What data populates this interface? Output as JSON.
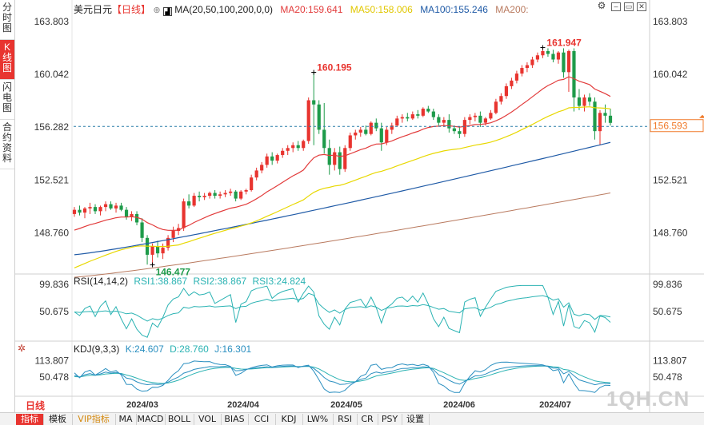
{
  "symbol": "美元日元",
  "period": "【日线】",
  "side_tabs": [
    "分时图",
    "K线图",
    "闪电图",
    "合约资料"
  ],
  "active_tab": "K线图",
  "ma": {
    "label": "MA(20,50,100,200,0,0)",
    "ma20": "MA20:159.641",
    "ma50": "MA50:158.006",
    "ma100": "MA100:155.246",
    "ma200": "MA200:"
  },
  "rsi": {
    "label": "RSI(14,14,2)",
    "rsi1": "RSI1:38.867",
    "rsi2": "RSI2:38.867",
    "rsi3": "RSI3:24.824"
  },
  "kdj": {
    "label": "KDJ(9,3,3)",
    "k": "K:24.607",
    "d": "D:28.760",
    "j": "J:16.301"
  },
  "bottom_left": "日线",
  "bottom_tabs": [
    "指标",
    "模板",
    "VIP指标",
    "MA",
    "MACD",
    "BOLL",
    "VOL",
    "BIAS",
    "CCI",
    "KDJ",
    "LW%",
    "RSI",
    "CR",
    "PSY",
    "设置"
  ],
  "watermark": "1QH.CN",
  "colors": {
    "up": "#e8342f",
    "down": "#1e9b4a",
    "ma20": "#e23b3b",
    "ma50": "#e8d800",
    "ma100": "#1f5aa6",
    "ma200": "#b97a5f",
    "rsi": "#2bb3b3",
    "kdj_k": "#2a8fc0",
    "current": "#f07a2a",
    "high_label": "#e8342f",
    "low_label": "#1e9b4a"
  },
  "icons": [
    "settings-icon",
    "minimize-icon",
    "restore-icon",
    "close-icon"
  ],
  "chart_data": [
    {
      "type": "candlestick",
      "x_labels": [
        "2024/03",
        "2024/04",
        "2024/05",
        "2024/06",
        "2024/07"
      ],
      "y_ticks": [
        "163.803",
        "160.042",
        "156.282",
        "152.521",
        "148.760"
      ],
      "ylim": [
        146.0,
        164.2
      ],
      "current_price": "156.593",
      "high_annotation": "161.947",
      "high_label_left": "160.195",
      "low_annotation": "146.477",
      "ohlc": [
        [
          150.1,
          150.6,
          149.9,
          150.4
        ],
        [
          150.4,
          150.7,
          150.0,
          150.2
        ],
        [
          150.2,
          150.6,
          149.8,
          150.5
        ],
        [
          150.5,
          150.9,
          150.1,
          150.6
        ],
        [
          150.6,
          150.8,
          150.1,
          150.3
        ],
        [
          150.3,
          150.7,
          150.0,
          150.6
        ],
        [
          150.6,
          151.0,
          150.3,
          150.8
        ],
        [
          150.8,
          151.0,
          150.4,
          150.5
        ],
        [
          150.5,
          150.9,
          150.2,
          150.7
        ],
        [
          150.7,
          150.9,
          150.3,
          150.4
        ],
        [
          150.4,
          150.6,
          149.7,
          149.9
        ],
        [
          149.9,
          150.3,
          149.6,
          150.1
        ],
        [
          150.1,
          150.3,
          149.3,
          149.5
        ],
        [
          149.5,
          149.8,
          148.1,
          148.4
        ],
        [
          148.4,
          148.6,
          146.5,
          147.2
        ],
        [
          147.2,
          148.0,
          146.48,
          147.8
        ],
        [
          147.8,
          148.2,
          147.0,
          147.3
        ],
        [
          147.3,
          148.0,
          146.9,
          147.7
        ],
        [
          147.7,
          148.6,
          147.5,
          148.4
        ],
        [
          148.4,
          149.2,
          148.1,
          148.9
        ],
        [
          148.9,
          149.4,
          148.6,
          149.1
        ],
        [
          149.1,
          151.2,
          148.9,
          151.0
        ],
        [
          151.0,
          151.5,
          150.5,
          150.7
        ],
        [
          150.7,
          151.6,
          150.6,
          151.4
        ],
        [
          151.4,
          151.7,
          151.0,
          151.3
        ],
        [
          151.3,
          151.6,
          151.1,
          151.4
        ],
        [
          151.4,
          151.7,
          151.2,
          151.6
        ],
        [
          151.6,
          151.8,
          151.2,
          151.4
        ],
        [
          151.4,
          151.7,
          151.2,
          151.5
        ],
        [
          151.5,
          151.8,
          151.3,
          151.6
        ],
        [
          151.6,
          151.9,
          151.4,
          151.7
        ],
        [
          151.7,
          151.8,
          151.0,
          151.2
        ],
        [
          151.2,
          151.8,
          151.1,
          151.7
        ],
        [
          151.7,
          151.9,
          151.5,
          151.8
        ],
        [
          151.8,
          152.9,
          151.7,
          152.7
        ],
        [
          152.7,
          153.4,
          152.5,
          153.2
        ],
        [
          153.2,
          153.8,
          153.0,
          153.6
        ],
        [
          153.6,
          154.4,
          153.4,
          154.2
        ],
        [
          154.2,
          154.5,
          153.6,
          153.9
        ],
        [
          153.9,
          154.4,
          153.7,
          154.3
        ],
        [
          154.3,
          154.8,
          154.1,
          154.6
        ],
        [
          154.6,
          155.0,
          154.3,
          154.8
        ],
        [
          154.8,
          155.2,
          154.5,
          155.0
        ],
        [
          155.0,
          155.3,
          154.6,
          154.8
        ],
        [
          154.8,
          155.4,
          154.6,
          155.3
        ],
        [
          155.3,
          158.4,
          155.1,
          158.2
        ],
        [
          158.2,
          160.19,
          155.0,
          157.9
        ],
        [
          157.9,
          158.2,
          155.8,
          156.1
        ],
        [
          156.1,
          158.0,
          154.4,
          154.8
        ],
        [
          154.8,
          155.4,
          152.9,
          153.6
        ],
        [
          153.6,
          154.8,
          153.2,
          154.5
        ],
        [
          154.5,
          154.9,
          152.9,
          153.3
        ],
        [
          153.3,
          155.0,
          153.1,
          154.8
        ],
        [
          154.8,
          155.9,
          154.6,
          155.7
        ],
        [
          155.7,
          156.1,
          155.4,
          155.9
        ],
        [
          155.9,
          156.3,
          155.6,
          156.1
        ],
        [
          156.1,
          156.4,
          155.7,
          155.8
        ],
        [
          155.8,
          156.7,
          155.7,
          156.6
        ],
        [
          156.6,
          156.9,
          156.0,
          156.2
        ],
        [
          156.2,
          156.6,
          154.6,
          155.2
        ],
        [
          155.2,
          156.3,
          155.0,
          156.1
        ],
        [
          156.1,
          156.6,
          155.8,
          156.4
        ],
        [
          156.4,
          157.1,
          156.3,
          156.9
        ],
        [
          156.9,
          157.2,
          156.6,
          157.0
        ],
        [
          157.0,
          157.3,
          156.7,
          156.9
        ],
        [
          156.9,
          157.4,
          156.8,
          157.2
        ],
        [
          157.2,
          157.5,
          156.9,
          157.1
        ],
        [
          157.1,
          157.7,
          157.0,
          157.6
        ],
        [
          157.6,
          157.8,
          157.3,
          157.4
        ],
        [
          157.4,
          157.6,
          156.8,
          157.0
        ],
        [
          157.0,
          157.2,
          156.4,
          156.6
        ],
        [
          156.6,
          157.0,
          156.3,
          156.8
        ],
        [
          156.8,
          157.2,
          155.9,
          156.2
        ],
        [
          156.2,
          156.4,
          155.8,
          156.0
        ],
        [
          156.0,
          156.3,
          155.5,
          155.8
        ],
        [
          155.8,
          157.0,
          155.6,
          156.8
        ],
        [
          156.8,
          157.2,
          156.5,
          157.0
        ],
        [
          157.0,
          157.3,
          156.7,
          157.1
        ],
        [
          157.1,
          157.4,
          156.3,
          156.6
        ],
        [
          156.6,
          157.0,
          156.4,
          156.9
        ],
        [
          156.9,
          157.5,
          156.8,
          157.3
        ],
        [
          157.3,
          158.3,
          157.2,
          158.1
        ],
        [
          158.1,
          158.7,
          157.9,
          158.5
        ],
        [
          158.5,
          159.4,
          158.3,
          159.2
        ],
        [
          159.2,
          159.8,
          159.0,
          159.6
        ],
        [
          159.6,
          160.3,
          159.4,
          160.1
        ],
        [
          160.1,
          160.7,
          159.9,
          160.5
        ],
        [
          160.5,
          160.9,
          160.2,
          160.7
        ],
        [
          160.7,
          161.3,
          160.5,
          161.1
        ],
        [
          161.1,
          161.6,
          160.9,
          161.4
        ],
        [
          161.4,
          161.95,
          161.2,
          161.7
        ],
        [
          161.7,
          161.9,
          161.3,
          161.5
        ],
        [
          161.5,
          161.8,
          160.9,
          161.1
        ],
        [
          161.1,
          161.7,
          160.8,
          161.6
        ],
        [
          161.6,
          161.9,
          159.8,
          160.2
        ],
        [
          160.2,
          161.8,
          158.8,
          161.7
        ],
        [
          161.7,
          161.9,
          157.4,
          158.4
        ],
        [
          158.4,
          159.0,
          157.5,
          157.8
        ],
        [
          157.8,
          158.6,
          157.4,
          158.4
        ],
        [
          158.4,
          158.7,
          157.8,
          158.1
        ],
        [
          158.1,
          158.4,
          155.4,
          156.0
        ],
        [
          156.0,
          157.5,
          155.0,
          157.3
        ],
        [
          157.3,
          157.9,
          156.6,
          157.1
        ],
        [
          157.1,
          157.6,
          156.4,
          156.59
        ]
      ],
      "ma_series": {
        "ma20_endpoints": [
          148.8,
          159.6
        ],
        "ma50_endpoints": [
          146.1,
          158.0
        ],
        "ma100_endpoints": [
          147.2,
          155.2
        ],
        "ma200_endpoints": [
          145.6,
          151.6
        ]
      }
    },
    {
      "type": "line",
      "name": "RSI",
      "y_ticks": [
        "99.836",
        "50.675"
      ],
      "ylim": [
        0,
        100
      ]
    },
    {
      "type": "line",
      "name": "KDJ",
      "y_ticks": [
        "113.807",
        "50.478"
      ],
      "ylim": [
        -10,
        130
      ]
    }
  ]
}
